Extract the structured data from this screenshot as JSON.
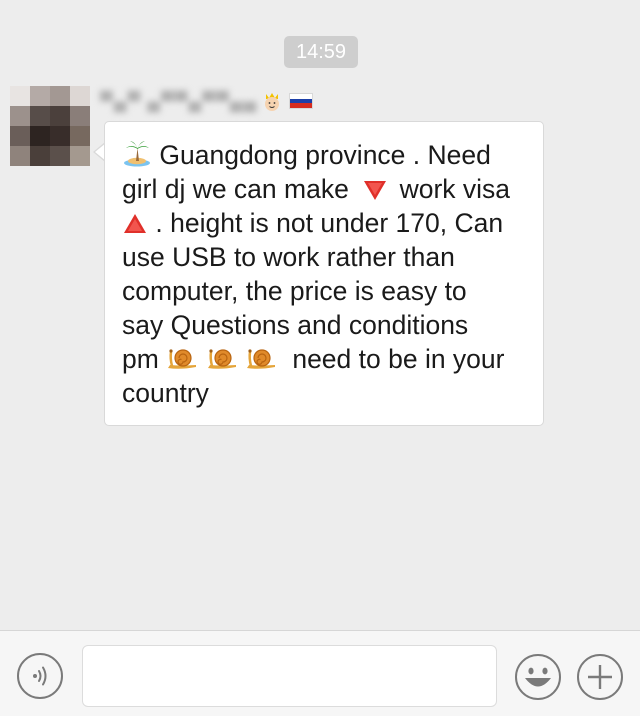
{
  "chat": {
    "timestamp": "14:59",
    "sender": {
      "name": "▀▄▀ ▄▀▀▄▀▀▄▄",
      "icons": [
        "user-emoji-icon",
        "russia-flag-icon"
      ]
    },
    "message": {
      "lines": [
        "Guangdong province . Need",
        "girl dj we can make",
        "work visa",
        ". height is not under 170, Can",
        "use USB to work rather than",
        "computer, the price is easy to",
        "say Questions and conditions",
        "pm",
        "need to be in your",
        "country"
      ],
      "emoji": [
        "desert-island-icon",
        "red-triangle-down-icon",
        "red-triangle-up-icon",
        "snail-icon"
      ]
    }
  },
  "input_bar": {
    "voice_icon": "voice-icon",
    "text_value": "",
    "emoji_icon": "smiley-face-icon",
    "add_icon": "plus-icon"
  },
  "colors": {
    "background": "#ededed",
    "bubble": "#ffffff",
    "timestamp_bg": "#cecece",
    "text": "#1a1a1a",
    "icon_gray": "#7a7a7a"
  }
}
